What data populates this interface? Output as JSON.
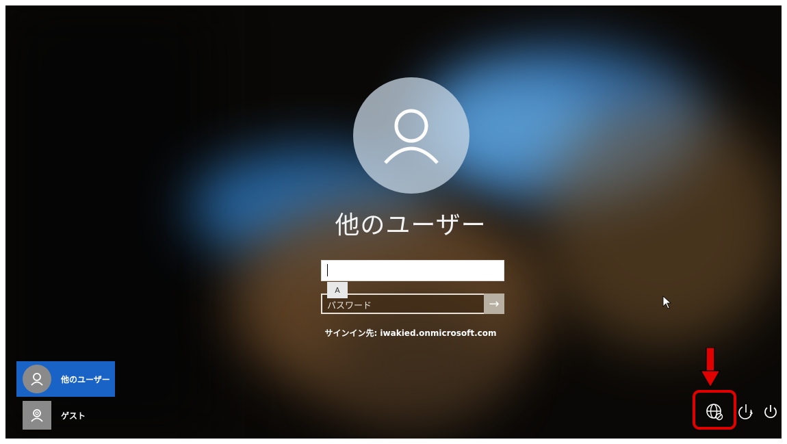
{
  "login": {
    "username": "他のユーザー",
    "ime_indicator": "A",
    "password_placeholder": "パスワード",
    "sign_in_to": "サインイン先: iwakied.onmicrosoft.com"
  },
  "users": [
    {
      "label": "他のユーザー",
      "selected": true
    },
    {
      "label": "ゲスト",
      "selected": false
    }
  ],
  "system_icons": [
    "network-icon",
    "accessibility-icon",
    "power-icon"
  ],
  "colors": {
    "accent": "#1a63c6",
    "highlight": "#e00000"
  }
}
